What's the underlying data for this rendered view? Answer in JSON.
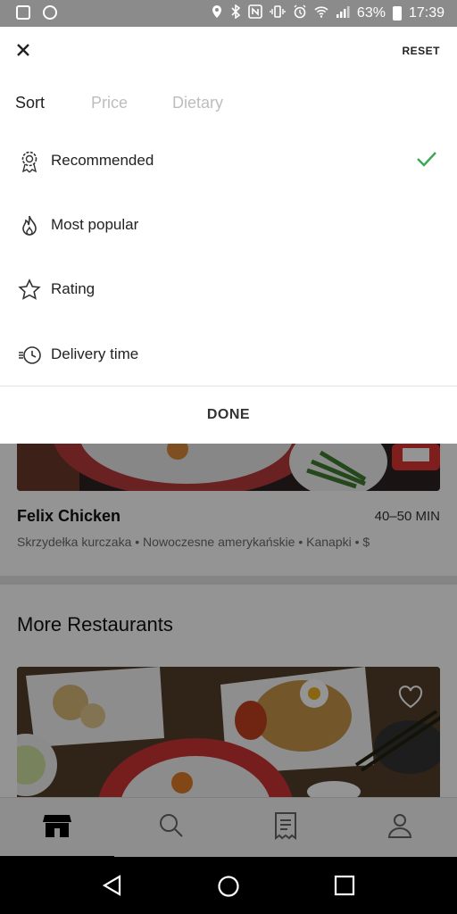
{
  "status_bar": {
    "battery": "63%",
    "time": "17:39"
  },
  "sheet": {
    "reset_label": "RESET",
    "tabs": [
      {
        "label": "Sort",
        "active": true
      },
      {
        "label": "Price",
        "active": false
      },
      {
        "label": "Dietary",
        "active": false
      }
    ],
    "options": [
      {
        "label": "Recommended",
        "icon": "badge-icon",
        "selected": true
      },
      {
        "label": "Most popular",
        "icon": "flame-icon",
        "selected": false
      },
      {
        "label": "Rating",
        "icon": "star-icon",
        "selected": false
      },
      {
        "label": "Delivery time",
        "icon": "clock-icon",
        "selected": false
      }
    ],
    "done_label": "DONE"
  },
  "background": {
    "restaurant": {
      "name": "Felix Chicken",
      "time": "40–50 MIN",
      "tags": "Skrzydełka kurczaka • Nowoczesne amerykańskie • Kanapki • $"
    },
    "section_title": "More Restaurants"
  },
  "tabbar": {
    "items": [
      {
        "icon": "home-icon",
        "active": true
      },
      {
        "icon": "search-icon",
        "active": false
      },
      {
        "icon": "receipt-icon",
        "active": false
      },
      {
        "icon": "account-icon",
        "active": false
      }
    ]
  },
  "colors": {
    "accent_check": "#3aa757",
    "overlay": "rgba(0,0,0,0.42)"
  }
}
